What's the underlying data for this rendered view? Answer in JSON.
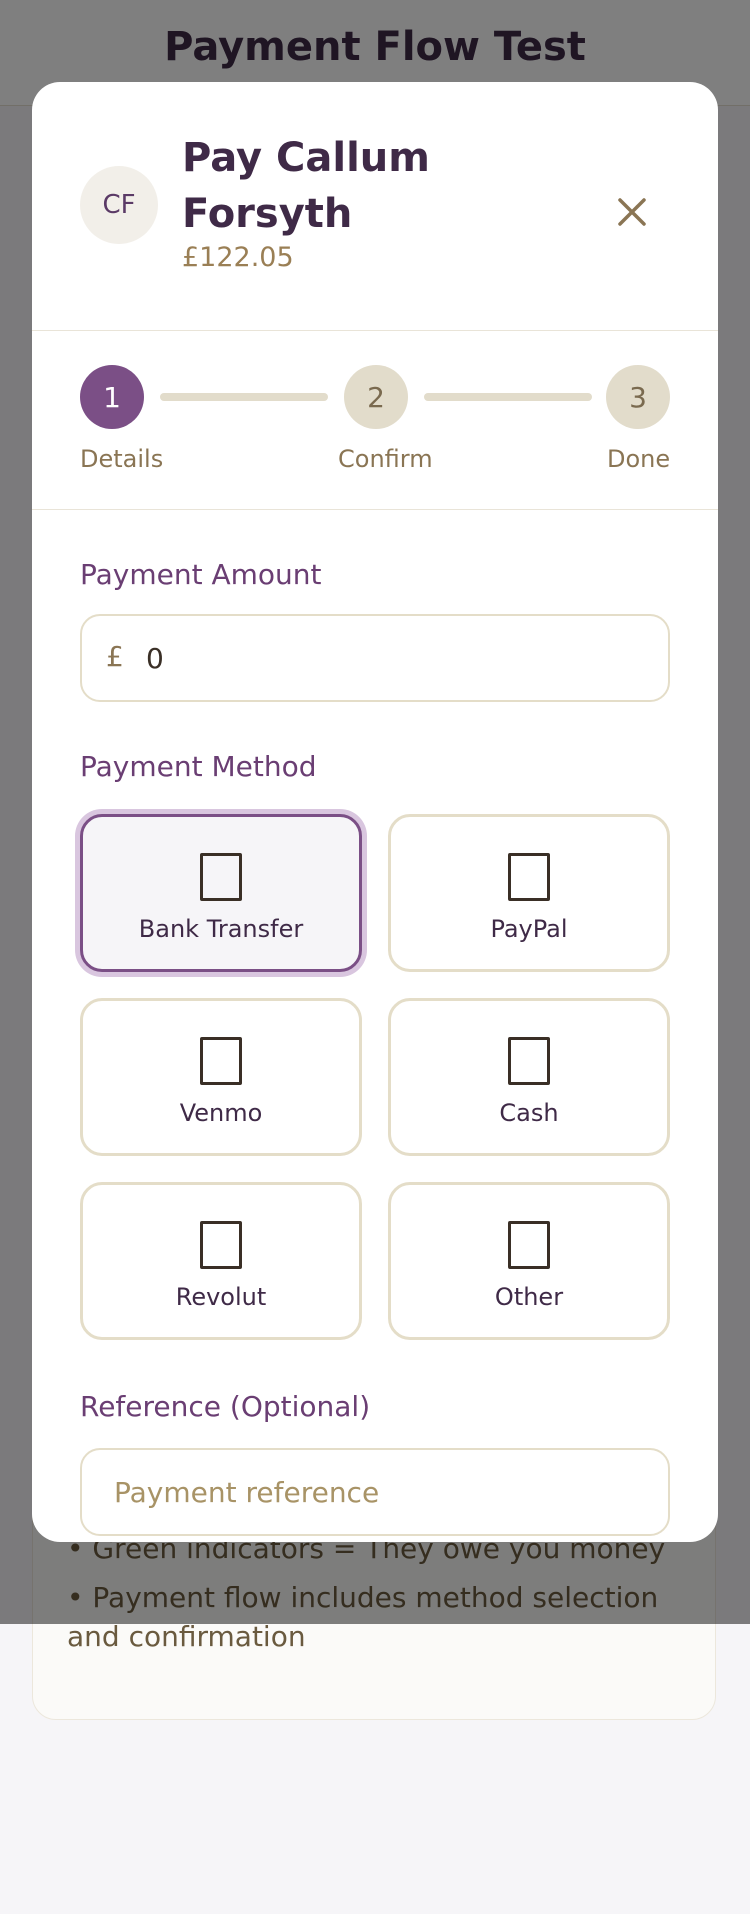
{
  "page": {
    "title": "Payment Flow Test"
  },
  "info": {
    "lines": [
      "• Green indicators = They owe you money",
      "• Payment flow includes method selection and confirmation"
    ]
  },
  "modal": {
    "avatar_initials": "CF",
    "title": "Pay Callum Forsyth",
    "amount_due": "£122.05",
    "close_icon": "close-icon"
  },
  "steps": [
    {
      "number": "1",
      "label": "Details",
      "state": "active"
    },
    {
      "number": "2",
      "label": "Confirm",
      "state": "pending"
    },
    {
      "number": "3",
      "label": "Done",
      "state": "pending"
    }
  ],
  "amount_field": {
    "label": "Payment Amount",
    "currency": "£",
    "value": "0"
  },
  "method_field": {
    "label": "Payment Method",
    "selected": "Bank Transfer",
    "options": [
      {
        "label": "Bank Transfer",
        "icon": "bank-icon"
      },
      {
        "label": "PayPal",
        "icon": "paypal-icon"
      },
      {
        "label": "Venmo",
        "icon": "venmo-icon"
      },
      {
        "label": "Cash",
        "icon": "cash-icon"
      },
      {
        "label": "Revolut",
        "icon": "revolut-icon"
      },
      {
        "label": "Other",
        "icon": "other-method-icon"
      }
    ]
  },
  "reference_field": {
    "label": "Reference (Optional)",
    "placeholder": "Payment reference",
    "value": ""
  },
  "colors": {
    "accent": "#7b4f86",
    "heading": "#3f2a47",
    "muted": "#8a7554",
    "border": "#e4ddc8"
  }
}
